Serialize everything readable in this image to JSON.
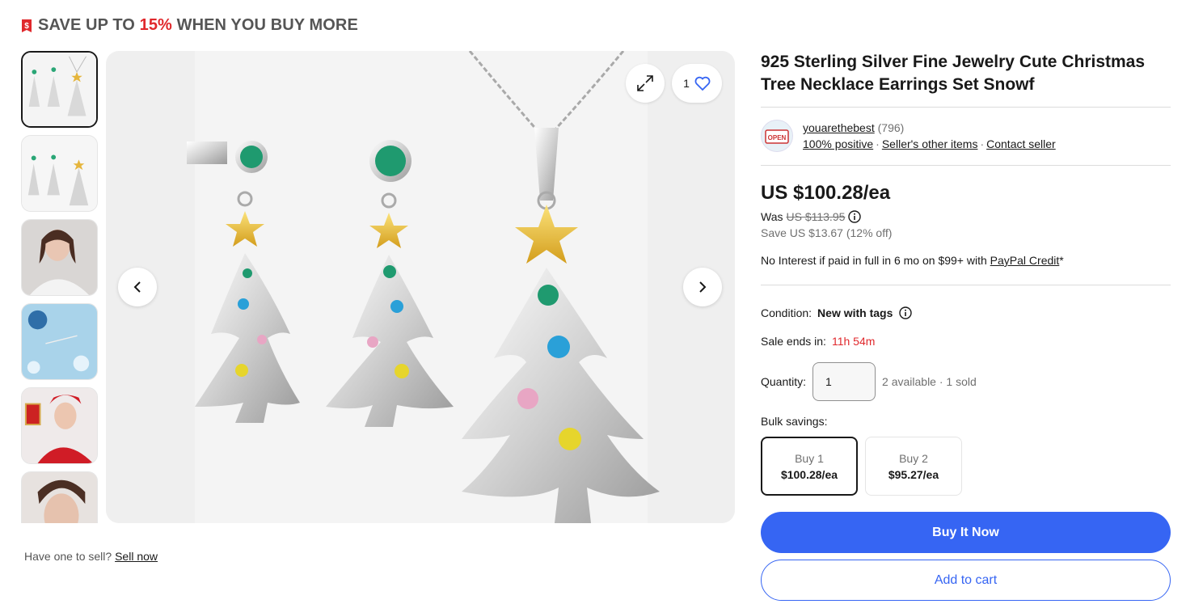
{
  "promo": {
    "prefix": "SAVE UP TO ",
    "percent": "15%",
    "suffix": " WHEN YOU BUY MORE",
    "icon": "price-tag-icon"
  },
  "gallery": {
    "thumbnails": [
      {
        "alt": "jewelry-set"
      },
      {
        "alt": "jewelry-set-alt"
      },
      {
        "alt": "model-wearing"
      },
      {
        "alt": "snowflake-display"
      },
      {
        "alt": "model-with-gift"
      },
      {
        "alt": "model-earring"
      }
    ],
    "watch_count": "1"
  },
  "sell": {
    "prefix": "Have one to sell? ",
    "link": "Sell now"
  },
  "listing": {
    "title": "925 Sterling Silver Fine Jewelry Cute Christmas Tree Necklace Earrings Set Snowf",
    "seller": {
      "name": "youarethebest",
      "feedback_count": "(796)",
      "positive": "100% positive",
      "other_items": "Seller's other items",
      "contact": "Contact seller"
    },
    "price": "US $100.28/ea",
    "was_label": "Was ",
    "was_price": "US $113.95",
    "save": "Save US $13.67 (12% off)",
    "credit_prefix": "No Interest if paid in full in 6 mo on $99+ with ",
    "credit_link": "PayPal Credit",
    "credit_suffix": "*",
    "condition_label": "Condition:",
    "condition_value": "New with tags",
    "sale_label": "Sale ends in:",
    "sale_value": "11h 54m",
    "quantity_label": "Quantity:",
    "quantity_value": "1",
    "availability": "2 available · 1 sold",
    "bulk_label": "Bulk savings:",
    "bulk": [
      {
        "qty": "Buy 1",
        "price": "$100.28/ea",
        "selected": true
      },
      {
        "qty": "Buy 2",
        "price": "$95.27/ea",
        "selected": false
      }
    ],
    "buy_now": "Buy It Now",
    "add_to_cart": "Add to cart"
  },
  "colors": {
    "accent": "#3665f3",
    "sale_red": "#e0282c"
  }
}
